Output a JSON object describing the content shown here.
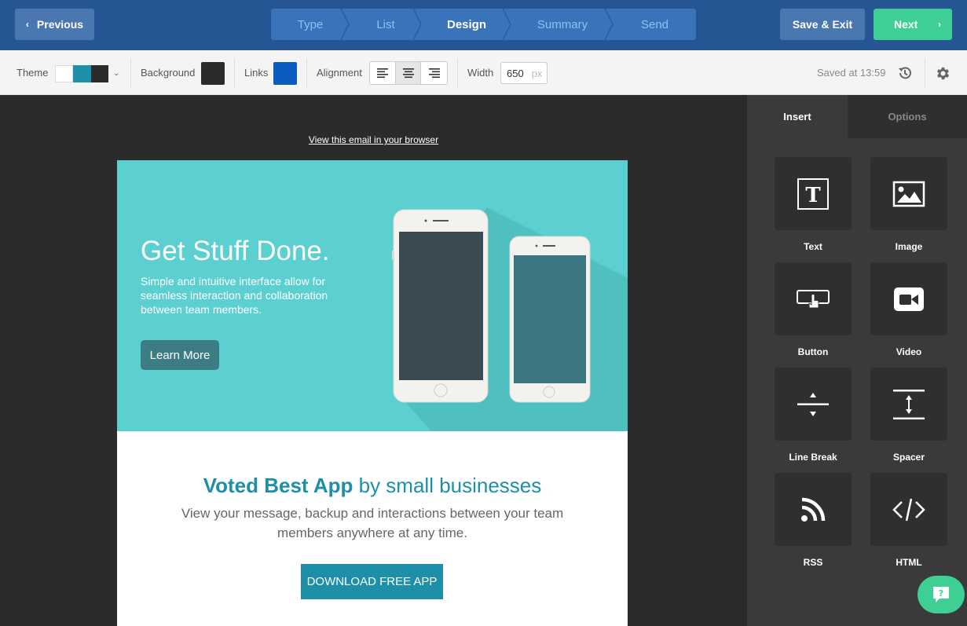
{
  "topbar": {
    "previous_label": "Previous",
    "steps": [
      "Type",
      "List",
      "Design",
      "Summary",
      "Send"
    ],
    "active_step": "Design",
    "save_exit_label": "Save & Exit",
    "next_label": "Next"
  },
  "toolbar": {
    "theme_label": "Theme",
    "theme_colors": [
      "#ffffff",
      "#1e8fa8",
      "#2b2b2b"
    ],
    "background_label": "Background",
    "background_color": "#2b2b2b",
    "links_label": "Links",
    "links_color": "#0c5cc0",
    "alignment_label": "Alignment",
    "active_alignment": "center",
    "width_label": "Width",
    "width_value": "650",
    "width_unit": "px",
    "saved_text": "Saved at 13:59"
  },
  "email": {
    "view_in_browser": "View this email in your browser",
    "hero_title": "Get Stuff Done.",
    "hero_text": "Simple and intuitive interface allow for seamless interaction and collaboration between team members.",
    "learn_more": "Learn More",
    "voted_bold": "Voted Best App",
    "voted_rest": " by small businesses",
    "voted_sub": "View your message, backup and interactions between your team members anywhere at any time.",
    "download_label": "DOWNLOAD FREE APP"
  },
  "panel": {
    "tabs": [
      "Insert",
      "Options"
    ],
    "active_tab": "Insert",
    "blocks": [
      "Text",
      "Image",
      "Button",
      "Video",
      "Line Break",
      "Spacer",
      "RSS",
      "HTML"
    ]
  },
  "colors": {
    "topbar": "#255592",
    "next_button": "#3ecf95",
    "hero": "#5ccfd0",
    "accent": "#1e8fa8"
  }
}
